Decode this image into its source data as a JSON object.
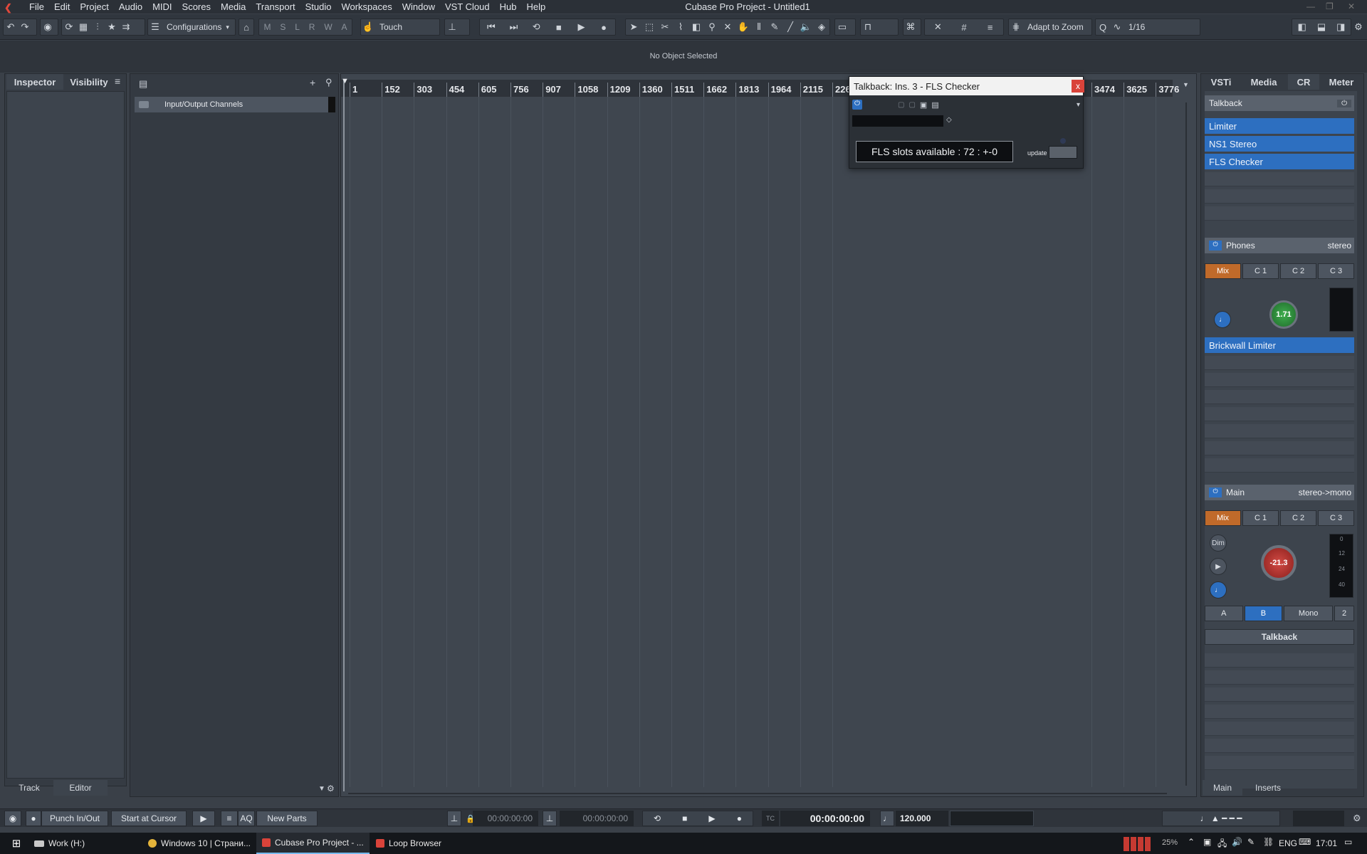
{
  "menubar": {
    "items": [
      "File",
      "Edit",
      "Project",
      "Audio",
      "MIDI",
      "Scores",
      "Media",
      "Transport",
      "Studio",
      "Workspaces",
      "Window",
      "VST Cloud",
      "Hub",
      "Help"
    ],
    "window_title": "Cubase Pro Project - Untitled1"
  },
  "toolbar": {
    "configurations_label": "Configurations",
    "state_buttons": [
      "M",
      "S",
      "L",
      "R",
      "W",
      "A"
    ],
    "automation_mode": "Touch",
    "adapt_zoom": "Adapt to Zoom",
    "quantize": "1/16"
  },
  "statusline": {
    "text": "No Object Selected"
  },
  "inspector": {
    "tabs": [
      "Inspector",
      "Visibility"
    ],
    "bottom_tabs": [
      "Track",
      "Editor"
    ]
  },
  "tracklist": {
    "folder_name": "Input/Output Channels"
  },
  "ruler": {
    "labels": [
      "1",
      "152",
      "303",
      "454",
      "605",
      "756",
      "907",
      "1058",
      "1209",
      "1360",
      "1511",
      "1662",
      "1813",
      "1964",
      "2115",
      "226",
      "3474",
      "3625",
      "3776"
    ]
  },
  "plugin_window": {
    "title": "Talkback: Ins. 3 - FLS Checker",
    "close_label": "x",
    "fls_text": "FLS slots available : 72 : +-0",
    "update_label": "update"
  },
  "rightzone": {
    "tabs": [
      "VSTi",
      "Media",
      "CR",
      "Meter"
    ],
    "talkback_header": "Talkback",
    "talkback_inserts": [
      "Limiter",
      "NS1 Stereo",
      "FLS Checker"
    ],
    "phones": {
      "label": "Phones",
      "format": "stereo",
      "buttons": [
        "Mix",
        "C 1",
        "C 2",
        "C 3"
      ],
      "knob_value": "1.71",
      "insert": "Brickwall Limiter"
    },
    "main": {
      "label": "Main",
      "format": "stereo->mono",
      "buttons": [
        "Mix",
        "C 1",
        "C 2",
        "C 3"
      ],
      "knob_value": "-21.3",
      "dim_label": "Dim",
      "meter_scale": [
        "0",
        "12",
        "24",
        "40"
      ],
      "out_buttons": [
        "A",
        "B",
        "Mono",
        "2"
      ],
      "talkback_button": "Talkback"
    },
    "bottom_tabs": [
      "Main",
      "Inserts"
    ]
  },
  "transport": {
    "punch_label": "Punch In/Out",
    "start_cursor_label": "Start at Cursor",
    "aq_label": "AQ",
    "new_parts_label": "New Parts",
    "left_locator": "00:00:00:00",
    "right_locator": "00:00:00:00",
    "tc_label": "TC",
    "position": "00:00:00:00",
    "tempo": "120.000"
  },
  "taskbar": {
    "tasks": [
      "Work (H:)",
      "Windows 10 | Страни...",
      "Cubase Pro Project - ...",
      "Loop Browser"
    ],
    "volume_pct": "25%",
    "language": "ENG",
    "clock": "17:01"
  }
}
